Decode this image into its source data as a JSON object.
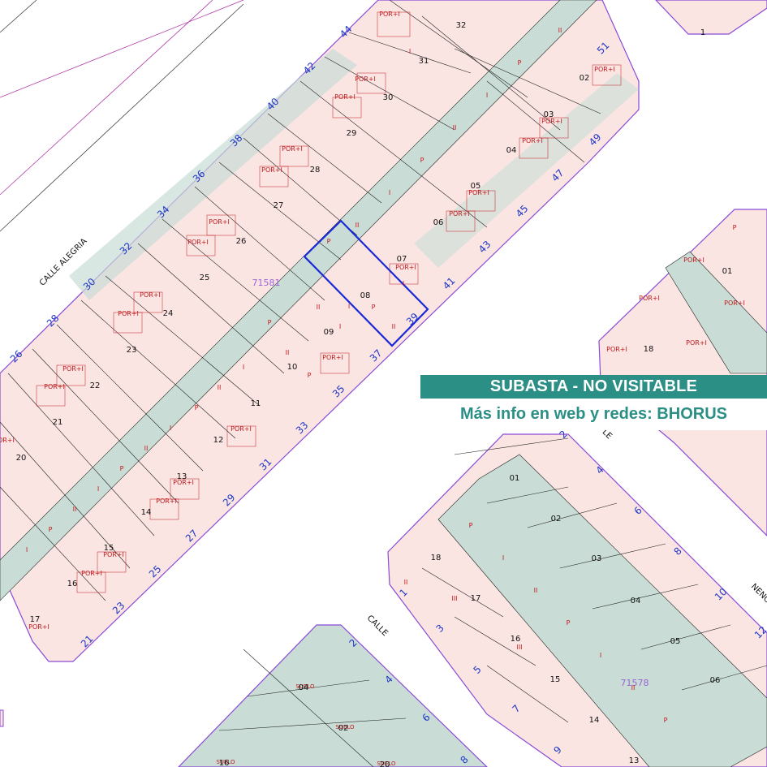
{
  "map": {
    "street_labels": [
      "CALLE ALEGRIA",
      "CALLE",
      "LE",
      "NENC"
    ],
    "block_ids": [
      "71581",
      "71578"
    ],
    "north_block": {
      "lots": [
        "32",
        "31",
        "30",
        "29",
        "28",
        "27",
        "26",
        "25",
        "24",
        "23",
        "22",
        "21",
        "20",
        "17",
        "16",
        "15",
        "14",
        "13",
        "12",
        "11",
        "10",
        "09",
        "08",
        "07",
        "06",
        "05",
        "04",
        "03",
        "02"
      ],
      "nw_house_numbers": [
        "44",
        "42",
        "40",
        "38",
        "36",
        "34",
        "32",
        "30",
        "28",
        "26"
      ],
      "se_house_numbers": [
        "51",
        "49",
        "47",
        "45",
        "43",
        "41",
        "39",
        "37",
        "35",
        "33",
        "31",
        "29",
        "27",
        "25",
        "23",
        "21"
      ]
    },
    "south_block": {
      "lots": [
        "01",
        "02",
        "03",
        "04",
        "05",
        "06",
        "13",
        "14",
        "15",
        "16",
        "17",
        "18"
      ],
      "house_numbers": [
        "2",
        "4",
        "6",
        "8",
        "10",
        "12",
        "1",
        "3",
        "5",
        "7",
        "9"
      ]
    },
    "east_block": {
      "lots": [
        "01",
        "18"
      ]
    },
    "bottom_block": {
      "labels": [
        "SUELO",
        "SUELO",
        "SUELO",
        "SUELO"
      ],
      "lots": [
        "04",
        "02",
        "16",
        "20"
      ],
      "house_numbers": [
        "2",
        "4",
        "6",
        "8"
      ]
    },
    "top_right_block": {
      "lots": [
        "1"
      ]
    },
    "floor_labels": [
      "P",
      "I",
      "II",
      "III",
      "POR+I"
    ],
    "highlighted_lot": "08",
    "colors": {
      "parcel_fill": "#fbe5e3",
      "courtyard_fill": "#c9ddd6",
      "parcel_line": "#c0191c",
      "block_edge": "#8a4ad6",
      "lot_line": "#222222",
      "house_number": "#1f38c7",
      "block_id": "#9a64d8",
      "highlight": "#1a29d8",
      "street_edge": "#b03aa8"
    }
  },
  "banner": {
    "title": "SUBASTA - NO VISITABLE",
    "subtitle": "Más info en web y redes: BHORUS"
  }
}
